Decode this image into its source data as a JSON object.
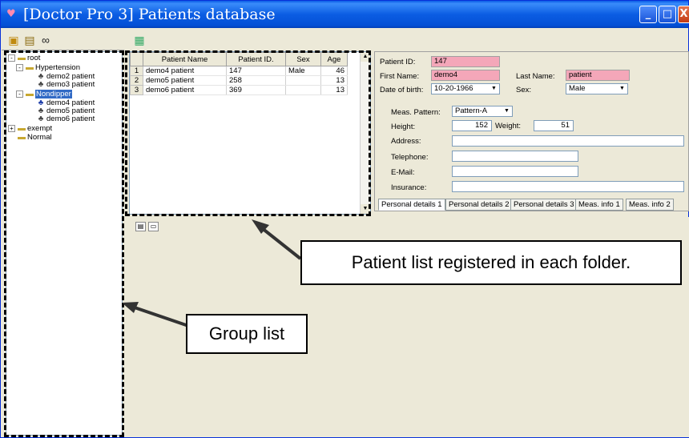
{
  "window": {
    "title": "[Doctor Pro 3] Patients database",
    "title_icon": "heart-icon",
    "controls": {
      "minimize": "_",
      "maximize": "□",
      "close": "X"
    }
  },
  "toolbar": {
    "left_icons": [
      "open-folder-icon",
      "edit-folder-icon",
      "binoculars-icon"
    ],
    "mid_icons": [
      "patient-card-icon"
    ]
  },
  "tree": {
    "nodes": [
      {
        "label": "root",
        "icon": "folder-icon",
        "expander": "-"
      },
      {
        "label": "Hypertension",
        "icon": "folder-icon",
        "expander": "-"
      },
      {
        "label": "demo2 patient",
        "icon": "patient-icon"
      },
      {
        "label": "demo3 patient",
        "icon": "patient-icon"
      },
      {
        "label": "Nondipper",
        "icon": "folder-icon",
        "expander": "-",
        "selected": true
      },
      {
        "label": "demo4 patient",
        "icon": "patient-icon"
      },
      {
        "label": "demo5 patient",
        "icon": "patient-icon"
      },
      {
        "label": "demo6 patient",
        "icon": "patient-icon"
      },
      {
        "label": "exempt",
        "icon": "folder-icon",
        "expander": "+"
      },
      {
        "label": "Normal",
        "icon": "folder-icon"
      }
    ]
  },
  "grid": {
    "columns": [
      "Patient Name",
      "Patient ID.",
      "Sex",
      "Age"
    ],
    "rows": [
      {
        "num": "1",
        "name": "demo4 patient",
        "id": "147",
        "sex": "Male",
        "age": "46"
      },
      {
        "num": "2",
        "name": "demo5 patient",
        "id": "258",
        "sex": "",
        "age": "13"
      },
      {
        "num": "3",
        "name": "demo6 patient",
        "id": "369",
        "sex": "",
        "age": "13"
      }
    ]
  },
  "details": {
    "patient_id_label": "Patient ID:",
    "patient_id": "147",
    "first_name_label": "First Name:",
    "first_name": "demo4",
    "last_name_label": "Last Name:",
    "last_name": "patient",
    "dob_label": "Date of birth:",
    "dob": "10-20-1966",
    "sex_label": "Sex:",
    "sex": "Male",
    "meas_pattern_label": "Meas. Pattern:",
    "meas_pattern": "Pattern-A",
    "height_label": "Height:",
    "height": "152",
    "weight_label": "Weight:",
    "weight": "51",
    "address_label": "Address:",
    "address": "",
    "telephone_label": "Telephone:",
    "telephone": "",
    "email_label": "E-Mail:",
    "email": "",
    "insurance_label": "Insurance:",
    "insurance": "",
    "tabs": [
      "Personal details 1",
      "Personal details 2",
      "Personal details 3",
      "Meas. info 1",
      "Meas. info 2"
    ]
  },
  "annotations": {
    "patient_list_caption": "Patient list registered in each folder.",
    "group_list_caption": "Group list"
  }
}
